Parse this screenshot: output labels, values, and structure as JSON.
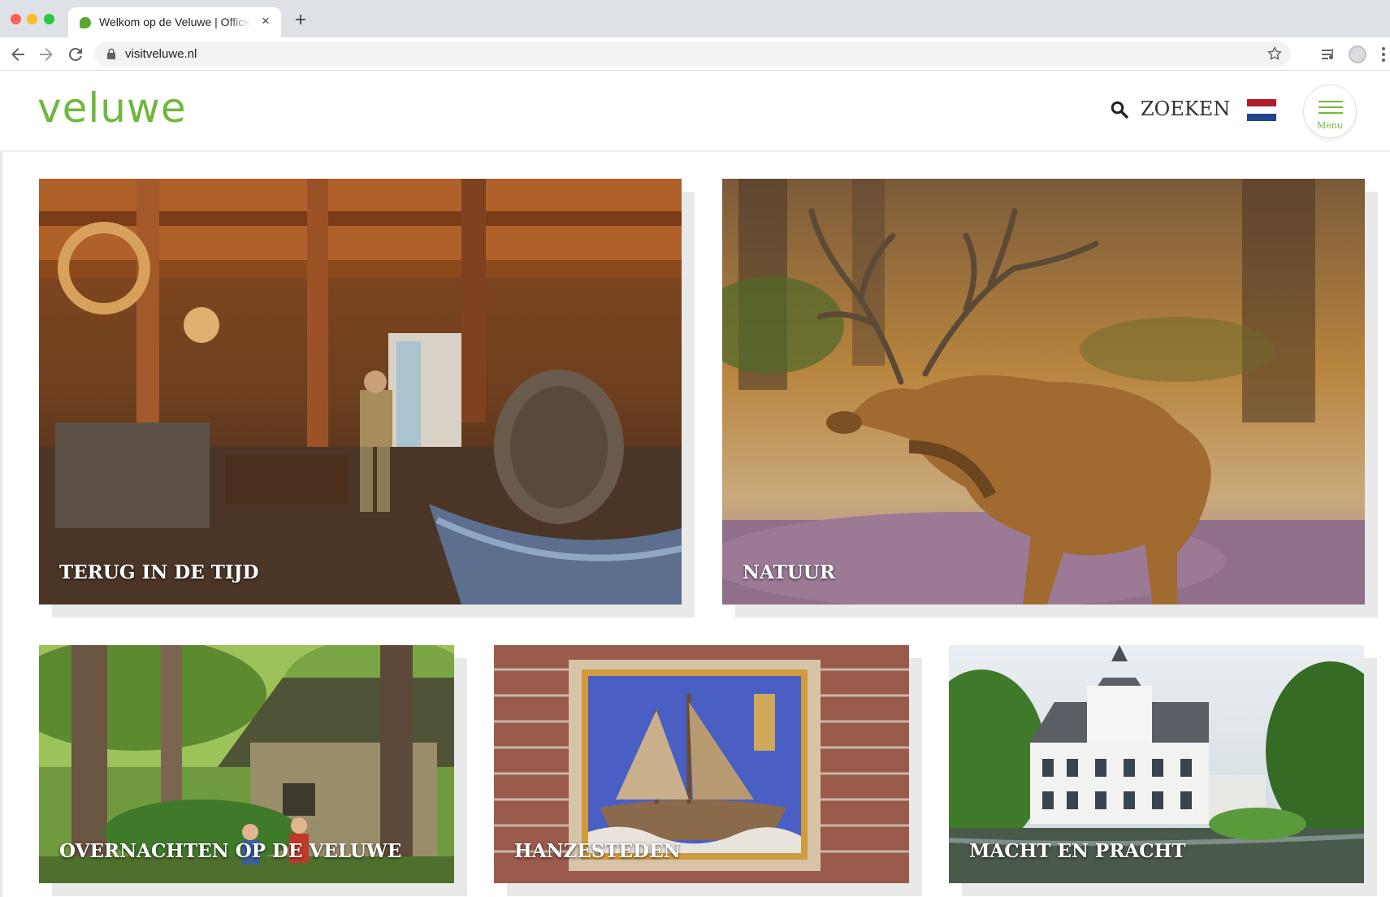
{
  "browser": {
    "tab_title": "Welkom op de Veluwe | Officiële",
    "tab_close": "×",
    "new_tab": "+",
    "url": "visitveluwe.nl"
  },
  "header": {
    "logo": "veluwe",
    "search_label": "ZOEKEN",
    "menu_label": "Menu",
    "flag_colors": [
      "#ae1c28",
      "#ffffff",
      "#21468b"
    ],
    "accent_color": "#6fb83f"
  },
  "tiles": [
    {
      "title": "TERUG IN DE TIJD",
      "icon": "mill-interior-photo"
    },
    {
      "title": "NATUUR",
      "icon": "red-deer-photo"
    },
    {
      "title": "OVERNACHTEN OP DE VELUWE",
      "icon": "forest-tent-photo"
    },
    {
      "title": "HANZESTEDEN",
      "icon": "gable-stone-ship-photo"
    },
    {
      "title": "MACHT EN PRACHT",
      "icon": "castle-photo"
    }
  ]
}
